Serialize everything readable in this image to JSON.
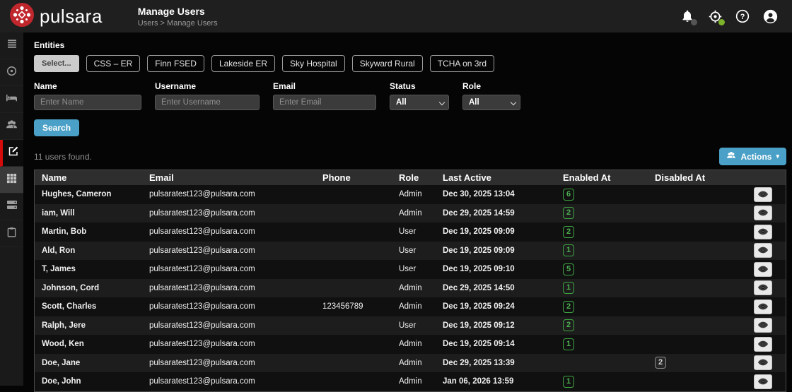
{
  "brand": "pulsara",
  "header": {
    "title": "Manage Users",
    "breadcrumb": "Users > Manage Users",
    "icons": [
      "bell-icon",
      "crosshair-icon",
      "help-icon",
      "account-icon"
    ]
  },
  "entities": {
    "label": "Entities",
    "select_label": "Select...",
    "chips": [
      "CSS – ER",
      "Finn FSED",
      "Lakeside ER",
      "Sky Hospital",
      "Skyward Rural",
      "TCHA on 3rd"
    ]
  },
  "filters": {
    "name": {
      "label": "Name",
      "placeholder": "Enter Name",
      "value": ""
    },
    "username": {
      "label": "Username",
      "placeholder": "Enter Username",
      "value": ""
    },
    "email": {
      "label": "Email",
      "placeholder": "Enter Email",
      "value": ""
    },
    "status": {
      "label": "Status",
      "value": "All"
    },
    "role": {
      "label": "Role",
      "value": "All"
    }
  },
  "search_label": "Search",
  "results_text": "11 users found.",
  "actions_label": "Actions",
  "table": {
    "columns": [
      "Name",
      "Email",
      "Phone",
      "Role",
      "Last Active",
      "Enabled At",
      "Disabled At",
      ""
    ],
    "rows": [
      {
        "name": "Hughes, Cameron",
        "email": "pulsaratest123@pulsara.com",
        "phone": "",
        "role": "Admin",
        "last_active": "Dec 30, 2025 13:04",
        "enabled_at": "6",
        "disabled_at": ""
      },
      {
        "name": "iam, Will",
        "email": "pulsaratest123@pulsara.com",
        "phone": "",
        "role": "Admin",
        "last_active": "Dec 29, 2025 14:59",
        "enabled_at": "2",
        "disabled_at": ""
      },
      {
        "name": "Martin, Bob",
        "email": "pulsaratest123@pulsara.com",
        "phone": "",
        "role": "User",
        "last_active": "Dec 19, 2025 09:09",
        "enabled_at": "2",
        "disabled_at": ""
      },
      {
        "name": "Ald, Ron",
        "email": "pulsaratest123@pulsara.com",
        "phone": "",
        "role": "User",
        "last_active": "Dec 19, 2025 09:09",
        "enabled_at": "1",
        "disabled_at": ""
      },
      {
        "name": "T, James",
        "email": "pulsaratest123@pulsara.com",
        "phone": "",
        "role": "User",
        "last_active": "Dec 19, 2025 09:10",
        "enabled_at": "5",
        "disabled_at": ""
      },
      {
        "name": "Johnson, Cord",
        "email": "pulsaratest123@pulsara.com",
        "phone": "",
        "role": "Admin",
        "last_active": "Dec 29, 2025 14:50",
        "enabled_at": "1",
        "disabled_at": ""
      },
      {
        "name": "Scott, Charles",
        "email": "pulsaratest123@pulsara.com",
        "phone": "123456789",
        "role": "Admin",
        "last_active": "Dec 19, 2025 09:24",
        "enabled_at": "2",
        "disabled_at": ""
      },
      {
        "name": "Ralph, Jere",
        "email": "pulsaratest123@pulsara.com",
        "phone": "",
        "role": "User",
        "last_active": "Dec 19, 2025 09:12",
        "enabled_at": "2",
        "disabled_at": ""
      },
      {
        "name": "Wood, Ken",
        "email": "pulsaratest123@pulsara.com",
        "phone": "",
        "role": "Admin",
        "last_active": "Dec 19, 2025 09:14",
        "enabled_at": "1",
        "disabled_at": ""
      },
      {
        "name": "Doe, Jane",
        "email": "pulsaratest123@pulsara.com",
        "phone": "",
        "role": "Admin",
        "last_active": "Dec 29, 2025 13:39",
        "enabled_at": "",
        "disabled_at": "2"
      },
      {
        "name": "Doe, John",
        "email": "pulsaratest123@pulsara.com",
        "phone": "",
        "role": "Admin",
        "last_active": "Jan 06, 2026 13:59",
        "enabled_at": "1",
        "disabled_at": ""
      }
    ]
  },
  "colors": {
    "accent_blue": "#4aa0c6",
    "badge_green": "#3fa543",
    "active_red": "#d40b0b",
    "brand_red": "#c0272d"
  }
}
